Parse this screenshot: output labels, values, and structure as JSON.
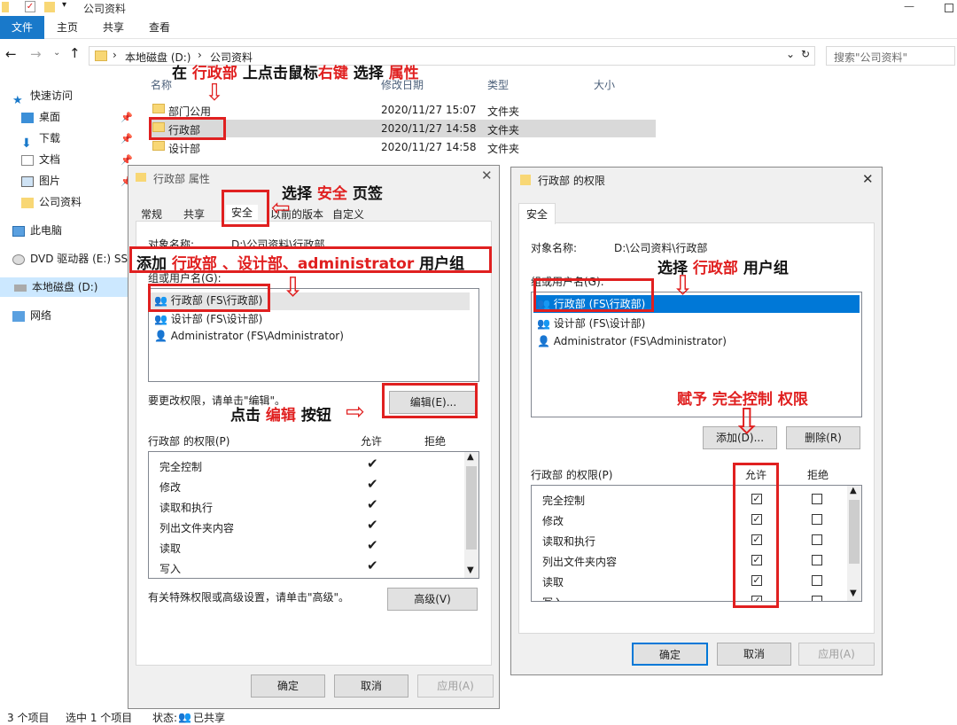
{
  "window": {
    "title": "公司资料"
  },
  "ribbon": {
    "tabs": [
      "文件",
      "主页",
      "共享",
      "查看"
    ]
  },
  "address": {
    "drive": "本地磁盘 (D:)",
    "folder": "公司资料",
    "search_placeholder": "搜索\"公司资料\""
  },
  "sidebar": {
    "items": [
      "快速访问",
      "桌面",
      "下载",
      "文档",
      "图片",
      "公司资料",
      "此电脑",
      "DVD 驱动器 (E:) SS",
      "本地磁盘 (D:)",
      "网络"
    ]
  },
  "filelist": {
    "headers": [
      "名称",
      "修改日期",
      "类型",
      "大小"
    ],
    "rows": [
      {
        "name": "部门公用",
        "date": "2020/11/27 15:07",
        "type": "文件夹"
      },
      {
        "name": "行政部",
        "date": "2020/11/27 14:58",
        "type": "文件夹"
      },
      {
        "name": "设计部",
        "date": "2020/11/27 14:58",
        "type": "文件夹"
      }
    ]
  },
  "status": {
    "count": "3 个项目",
    "selected": "选中 1 个项目",
    "state_label": "状态:",
    "state_value": "已共享"
  },
  "props": {
    "title": "行政部 属性",
    "tabs": [
      "常规",
      "共享",
      "安全",
      "以前的版本",
      "自定义"
    ],
    "object_label": "对象名称:",
    "object_value": "D:\\公司资料\\行政部",
    "group_label": "组或用户名(G):",
    "groups": [
      "行政部 (FS\\行政部)",
      "设计部 (FS\\设计部)",
      "Administrator (FS\\Administrator)"
    ],
    "change_hint": "要更改权限，请单击\"编辑\"。",
    "edit_button": "编辑(E)...",
    "perm_label": "行政部 的权限(P)",
    "allow": "允许",
    "deny": "拒绝",
    "perms": [
      "完全控制",
      "修改",
      "读取和执行",
      "列出文件夹内容",
      "读取",
      "写入"
    ],
    "adv_hint": "有关特殊权限或高级设置，请单击\"高级\"。",
    "adv_button": "高级(V)",
    "ok": "确定",
    "cancel": "取消",
    "apply": "应用(A)"
  },
  "perm": {
    "title": "行政部 的权限",
    "tab": "安全",
    "object_label": "对象名称:",
    "object_value": "D:\\公司资料\\行政部",
    "group_label": "组或用户名(G):",
    "groups": [
      "行政部 (FS\\行政部)",
      "设计部 (FS\\设计部)",
      "Administrator (FS\\Administrator)"
    ],
    "add_button": "添加(D)...",
    "remove_button": "删除(R)",
    "perm_label": "行政部 的权限(P)",
    "allow": "允许",
    "deny": "拒绝",
    "perms": [
      "完全控制",
      "修改",
      "读取和执行",
      "列出文件夹内容",
      "读取",
      "写入"
    ],
    "ok": "确定",
    "cancel": "取消",
    "apply": "应用(A)"
  },
  "annotations": {
    "a1": {
      "p1": "在 ",
      "r1": "行政部",
      "p2": " 上点击鼠标",
      "r2": "右键",
      "p3": " 选择 ",
      "r3": "属性"
    },
    "a2": {
      "p1": "选择 ",
      "r1": "安全",
      "p2": " 页签"
    },
    "a3": {
      "p1": "添加 ",
      "r1": "行政部 、设计部、administrator",
      "p2": " 用户组"
    },
    "a4": {
      "p1": "点击 ",
      "r1": "编辑",
      "p2": " 按钮"
    },
    "a5": {
      "p1": "选择 ",
      "r1": "行政部",
      "p2": " 用户组"
    },
    "a6": {
      "r1": "赋予 完全控制 权限"
    }
  },
  "colors": {
    "accent": "#0078d7",
    "annotation": "#e02020",
    "selection": "#cce8ff"
  }
}
